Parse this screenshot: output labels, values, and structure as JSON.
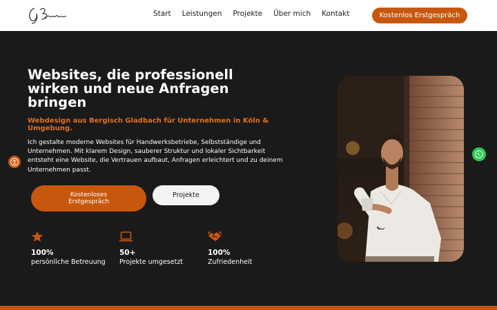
{
  "header": {
    "logo_text": "G.Baraka",
    "nav": [
      "Start",
      "Leistungen",
      "Projekte",
      "Über mich",
      "Kontakt"
    ],
    "cta": "Kostenlos Erstgespräch"
  },
  "hero": {
    "title": "Websites, die professionell wirken und neue Anfragen bringen",
    "subtitle": "Webdesign aus Bergisch Gladbach für Unternehmen in Köln & Umgebung.",
    "text": "Ich gestalte moderne Websites für Handwerksbetriebe, Selbstständige und Unternehmen. Mit klarem Design, sauberer Struktur und lokaler Sichtbarkeit entsteht eine Website, die Vertrauen aufbaut, Anfragen erleichtert und zu deinem Unternehmen passt.",
    "primary_button": "Kostenloses Erstgespräch",
    "secondary_button": "Projekte"
  },
  "stats": [
    {
      "icon": "star-icon",
      "value": "100%",
      "label": "persönliche Betreuung"
    },
    {
      "icon": "laptop-icon",
      "value": "50+",
      "label": "Projekte umgesetzt"
    },
    {
      "icon": "handshake-icon",
      "value": "100%",
      "label": "Zufriedenheit"
    }
  ],
  "widgets": {
    "accessibility_icon": "accessibility-icon",
    "whatsapp_icon": "whatsapp-icon"
  },
  "colors": {
    "accent": "#c8570e",
    "subtitle": "#e0711e",
    "background": "#1b1a1b",
    "whatsapp": "#2ec94f"
  }
}
